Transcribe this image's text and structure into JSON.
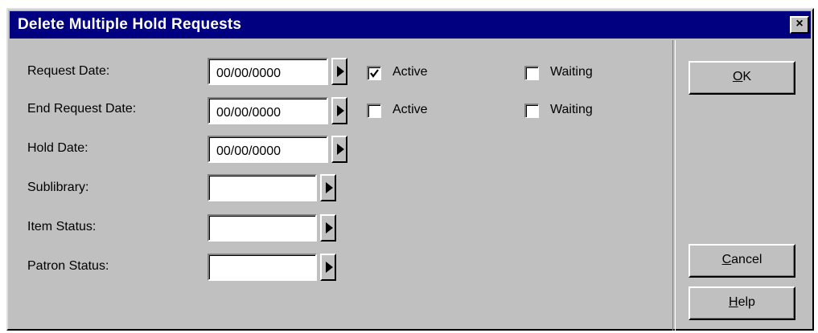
{
  "dialog": {
    "title": "Delete Multiple Hold Requests",
    "close_symbol": "×"
  },
  "fields": {
    "request_date": {
      "label": "Request Date:",
      "value": "00/00/0000"
    },
    "end_request_date": {
      "label": "End Request Date:",
      "value": "00/00/0000"
    },
    "hold_date": {
      "label": "Hold Date:",
      "value": "00/00/0000"
    },
    "sublibrary": {
      "label": "Sublibrary:",
      "value": ""
    },
    "item_status": {
      "label": "Item Status:",
      "value": ""
    },
    "patron_status": {
      "label": "Patron Status:",
      "value": ""
    }
  },
  "checkboxes": {
    "request_active": {
      "label": "Active",
      "checked": true
    },
    "request_waiting": {
      "label": "Waiting",
      "checked": false
    },
    "end_active": {
      "label": "Active",
      "checked": false
    },
    "end_waiting": {
      "label": "Waiting",
      "checked": false
    }
  },
  "buttons": {
    "ok": {
      "mnemonic": "O",
      "rest": "K"
    },
    "cancel": {
      "mnemonic": "C",
      "rest": "ancel"
    },
    "help": {
      "mnemonic": "H",
      "rest": "elp"
    }
  },
  "icons": {
    "arrow": "triangle-right-icon",
    "check": "checkmark-icon",
    "close": "close-icon"
  },
  "colors": {
    "titlebar": "#000080",
    "face": "#c0c0c0"
  }
}
